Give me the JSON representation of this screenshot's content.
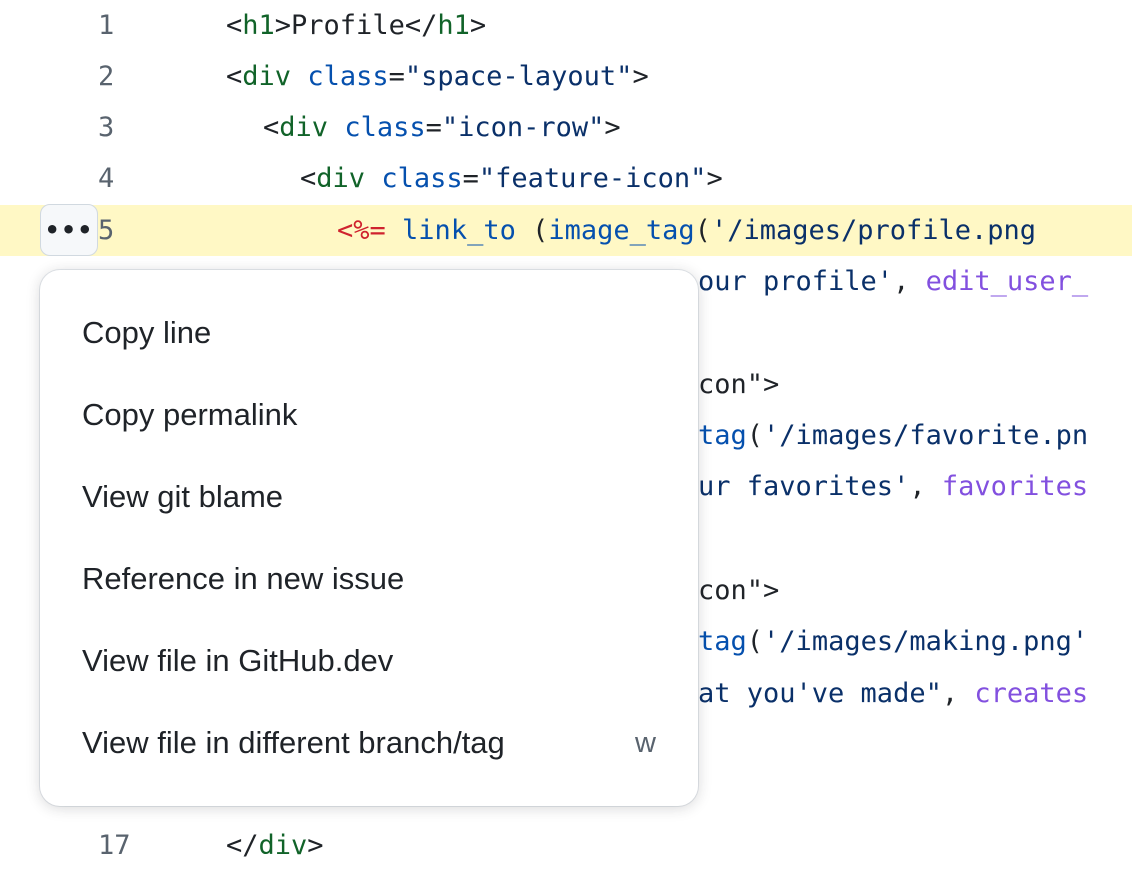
{
  "code": {
    "lines": [
      {
        "num": "1",
        "segments": [
          {
            "t": "<",
            "c": "plain"
          },
          {
            "t": "h1",
            "c": "tag"
          },
          {
            "t": ">Profile</",
            "c": "plain"
          },
          {
            "t": "h1",
            "c": "tag"
          },
          {
            "t": ">",
            "c": "plain"
          }
        ]
      },
      {
        "num": "2",
        "segments": [
          {
            "t": "<",
            "c": "plain"
          },
          {
            "t": "div",
            "c": "tag"
          },
          {
            "t": " ",
            "c": "plain"
          },
          {
            "t": "class",
            "c": "attr"
          },
          {
            "t": "=",
            "c": "plain"
          },
          {
            "t": "\"space-layout\"",
            "c": "str"
          },
          {
            "t": ">",
            "c": "plain"
          }
        ]
      },
      {
        "num": "3",
        "segments": [
          {
            "t": "<",
            "c": "plain"
          },
          {
            "t": "div",
            "c": "tag"
          },
          {
            "t": " ",
            "c": "plain"
          },
          {
            "t": "class",
            "c": "attr"
          },
          {
            "t": "=",
            "c": "plain"
          },
          {
            "t": "\"icon-row\"",
            "c": "str"
          },
          {
            "t": ">",
            "c": "plain"
          }
        ]
      },
      {
        "num": "4",
        "segments": [
          {
            "t": "<",
            "c": "plain"
          },
          {
            "t": "div",
            "c": "tag"
          },
          {
            "t": " ",
            "c": "plain"
          },
          {
            "t": "class",
            "c": "attr"
          },
          {
            "t": "=",
            "c": "plain"
          },
          {
            "t": "\"feature-icon\"",
            "c": "str"
          },
          {
            "t": ">",
            "c": "plain"
          }
        ]
      },
      {
        "num": "5",
        "segments": [
          {
            "t": "<%=",
            "c": "erb"
          },
          {
            "t": " ",
            "c": "plain"
          },
          {
            "t": "link_to",
            "c": "attr"
          },
          {
            "t": " (",
            "c": "plain"
          },
          {
            "t": "image_tag",
            "c": "attr"
          },
          {
            "t": "(",
            "c": "plain"
          },
          {
            "t": "'/images/profile.png",
            "c": "str"
          }
        ]
      },
      {
        "num": "",
        "segments": [
          {
            "t": "our profile'",
            "c": "str"
          },
          {
            "t": ", ",
            "c": "plain"
          },
          {
            "t": "edit_user_",
            "c": "fn"
          }
        ]
      },
      {
        "num": "",
        "segments": [
          {
            "t": "con\">",
            "c": "plain"
          }
        ]
      },
      {
        "num": "",
        "segments": [
          {
            "t": "tag",
            "c": "attr"
          },
          {
            "t": "(",
            "c": "plain"
          },
          {
            "t": "'/images/favorite.pn",
            "c": "str"
          }
        ]
      },
      {
        "num": "",
        "segments": [
          {
            "t": "ur favorites'",
            "c": "str"
          },
          {
            "t": ", ",
            "c": "plain"
          },
          {
            "t": "favorites",
            "c": "fn"
          }
        ]
      },
      {
        "num": "",
        "segments": [
          {
            "t": "con\">",
            "c": "plain"
          }
        ]
      },
      {
        "num": "",
        "segments": [
          {
            "t": "tag",
            "c": "attr"
          },
          {
            "t": "(",
            "c": "plain"
          },
          {
            "t": "'/images/making.png'",
            "c": "str"
          }
        ]
      },
      {
        "num": "",
        "segments": [
          {
            "t": "at you've made\"",
            "c": "str"
          },
          {
            "t": ", ",
            "c": "plain"
          },
          {
            "t": "creates",
            "c": "fn"
          }
        ]
      },
      {
        "num": "17",
        "segments": [
          {
            "t": "</",
            "c": "plain"
          },
          {
            "t": "div",
            "c": "tag"
          },
          {
            "t": ">",
            "c": "plain"
          }
        ]
      }
    ]
  },
  "line_actions_button": {
    "label": "•••"
  },
  "context_menu": {
    "items": [
      {
        "label": "Copy line",
        "shortcut": ""
      },
      {
        "label": "Copy permalink",
        "shortcut": ""
      },
      {
        "label": "View git blame",
        "shortcut": ""
      },
      {
        "label": "Reference in new issue",
        "shortcut": ""
      },
      {
        "label": "View file in GitHub.dev",
        "shortcut": ""
      },
      {
        "label": "View file in different branch/tag",
        "shortcut": "w"
      }
    ]
  },
  "colors": {
    "highlight_line": "#fff8c5",
    "tag": "#116329",
    "attribute": "#0550ae",
    "string": "#0a3069",
    "erb": "#cf222e",
    "function": "#8250df",
    "line_number": "#59636e"
  }
}
